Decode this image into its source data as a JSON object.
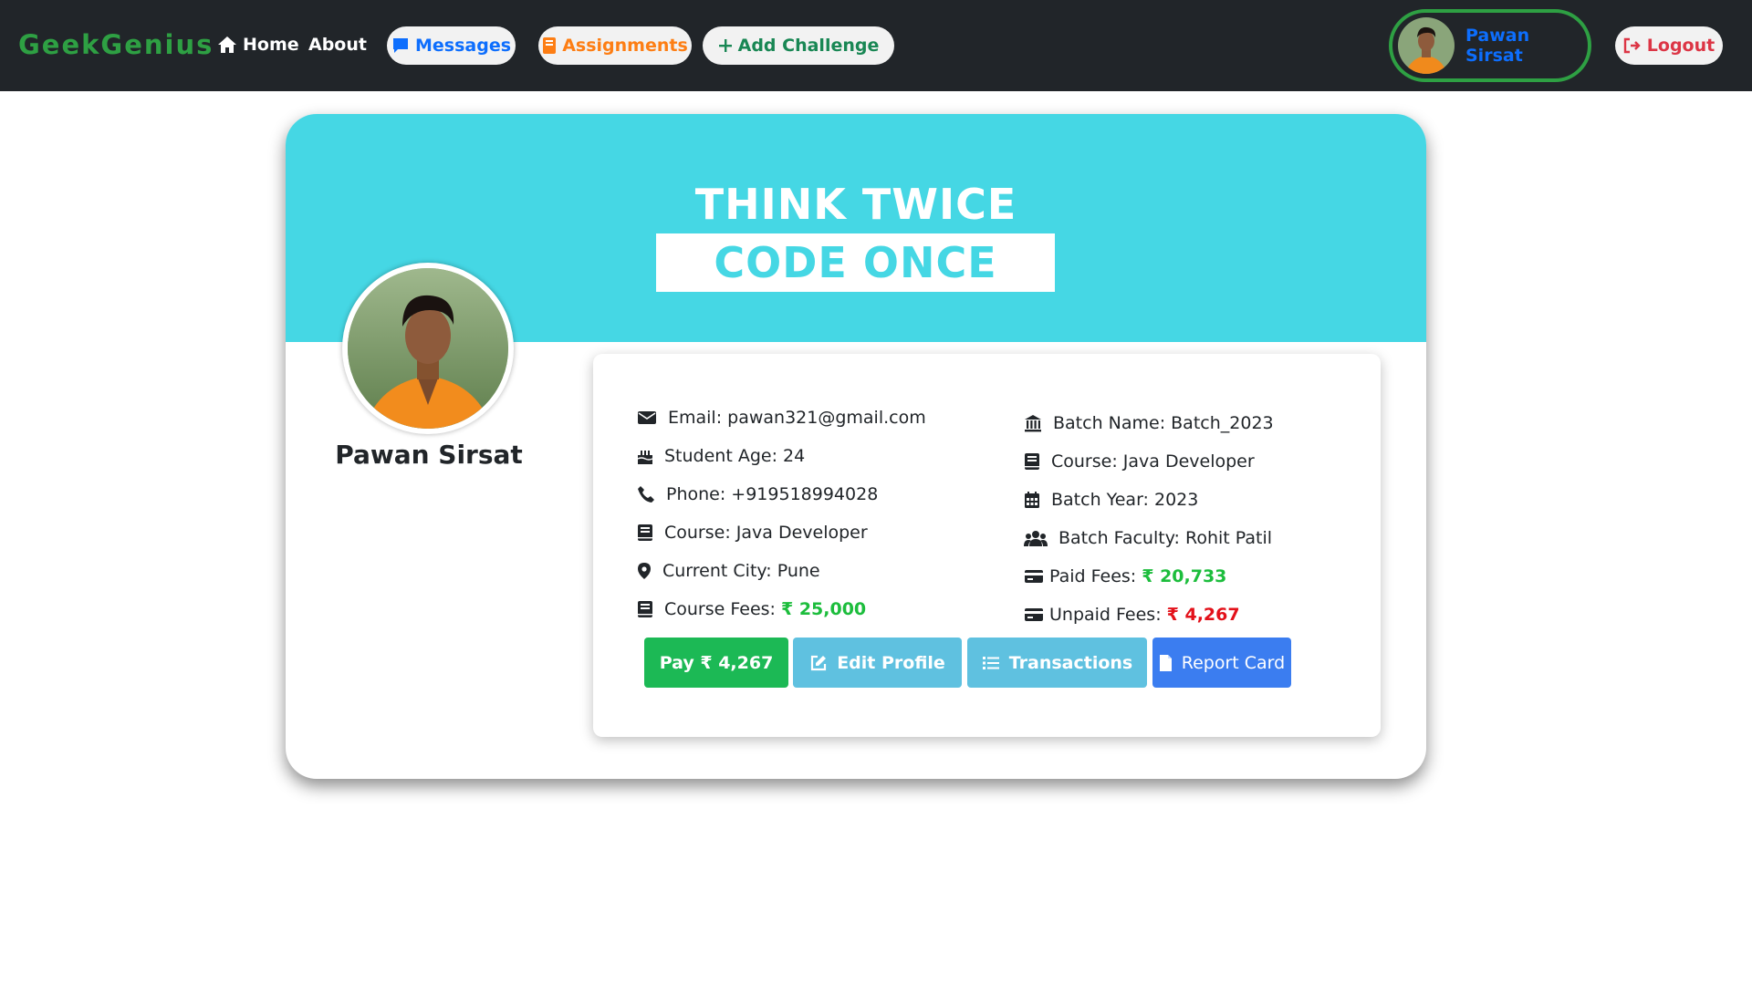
{
  "navbar": {
    "brand": "GeekGenius",
    "home": "Home",
    "about": "About",
    "messages": "Messages",
    "assignments": "Assignments",
    "add_challenge": "Add Challenge",
    "user_name": "Pawan Sirsat",
    "logout": "Logout"
  },
  "banner": {
    "line1": "THINK TWICE",
    "line2": "CODE ONCE"
  },
  "profile": {
    "name": "Pawan Sirsat"
  },
  "details_left": {
    "email": "Email: pawan321@gmail.com",
    "age": "Student Age: 24",
    "phone": "Phone: +919518994028",
    "course": "Course: Java Developer",
    "city": "Current City: Pune",
    "fees_label": "Course Fees: ",
    "fees_value": "₹ 25,000"
  },
  "details_right": {
    "batch_name": "Batch Name: Batch_2023",
    "course": "Course: Java Developer",
    "batch_year": "Batch Year: 2023",
    "faculty": "Batch Faculty: Rohit Patil",
    "paid_label": "Paid Fees: ",
    "paid_value": "₹ 20,733",
    "unpaid_label": "Unpaid Fees: ",
    "unpaid_value": "₹ 4,267"
  },
  "actions": {
    "pay": "Pay ₹ 4,267",
    "edit": "Edit Profile",
    "transactions": "Transactions",
    "report": "Report Card"
  },
  "colors": {
    "navbar_bg": "#212529",
    "brand": "#2ea043",
    "banner": "#45d7e4",
    "paid": "#1cbd3c",
    "unpaid": "#e3111a"
  }
}
